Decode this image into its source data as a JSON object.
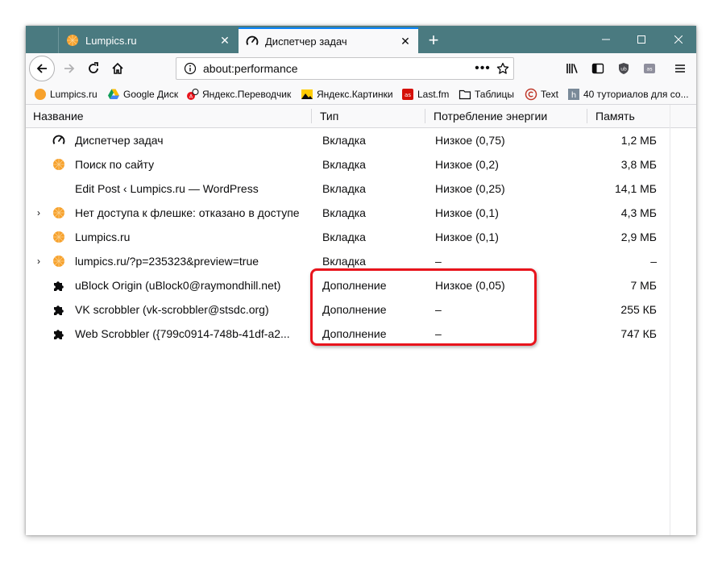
{
  "tabs": [
    {
      "title": "Lumpics.ru",
      "icon": "orange-circle-icon",
      "close": "✕"
    },
    {
      "title": "Диспетчер задач",
      "icon": "gauge-icon",
      "close": "✕"
    }
  ],
  "new_tab": "+",
  "window_controls": {
    "minimize": "—",
    "maximize": "☐",
    "close": "✕"
  },
  "url_bar": {
    "value": "about:performance",
    "dots": "•••"
  },
  "bookmarks": [
    {
      "label": "Lumpics.ru",
      "icon": "orange-circle-icon"
    },
    {
      "label": "Google Диск",
      "icon": "google-drive-icon"
    },
    {
      "label": "Яндекс.Переводчик",
      "icon": "yandex-translate-icon"
    },
    {
      "label": "Яндекс.Картинки",
      "icon": "yandex-images-icon"
    },
    {
      "label": "Last.fm",
      "icon": "lastfm-icon"
    },
    {
      "label": "Таблицы",
      "icon": "folder-icon"
    },
    {
      "label": "Text",
      "icon": "copyright-icon"
    },
    {
      "label": "40 туториалов для со...",
      "icon": "h-icon"
    }
  ],
  "table": {
    "headers": {
      "name": "Название",
      "type": "Тип",
      "energy": "Потребление энергии",
      "memory": "Память"
    },
    "rows": [
      {
        "twisty": "",
        "icon": "gauge-icon",
        "name": "Диспетчер задач",
        "type": "Вкладка",
        "energy": "Низкое (0,75)",
        "memory": "1,2 МБ"
      },
      {
        "twisty": "",
        "icon": "orange-circle-icon",
        "name": "Поиск по сайту",
        "type": "Вкладка",
        "energy": "Низкое (0,2)",
        "memory": "3,8 МБ"
      },
      {
        "twisty": "",
        "icon": "",
        "name": "Edit Post ‹ Lumpics.ru — WordPress",
        "type": "Вкладка",
        "energy": "Низкое (0,25)",
        "memory": "14,1 МБ"
      },
      {
        "twisty": "›",
        "icon": "orange-circle-icon",
        "name": "Нет доступа к флешке: отказано в доступе",
        "type": "Вкладка",
        "energy": "Низкое (0,1)",
        "memory": "4,3 МБ"
      },
      {
        "twisty": "",
        "icon": "orange-circle-icon",
        "name": "Lumpics.ru",
        "type": "Вкладка",
        "energy": "Низкое (0,1)",
        "memory": "2,9 МБ"
      },
      {
        "twisty": "›",
        "icon": "orange-circle-icon",
        "name": "lumpics.ru/?p=235323&preview=true",
        "type": "Вкладка",
        "energy": "–",
        "memory": "–"
      },
      {
        "twisty": "",
        "icon": "puzzle-icon",
        "name": "uBlock Origin (uBlock0@raymondhill.net)",
        "type": "Дополнение",
        "energy": "Низкое (0,05)",
        "memory": "7 МБ"
      },
      {
        "twisty": "",
        "icon": "puzzle-icon",
        "name": "VK scrobbler (vk-scrobbler@stsdc.org)",
        "type": "Дополнение",
        "energy": "–",
        "memory": "255 КБ"
      },
      {
        "twisty": "",
        "icon": "puzzle-icon",
        "name": "Web Scrobbler ({799c0914-748b-41df-a2...",
        "type": "Дополнение",
        "energy": "–",
        "memory": "747 КБ"
      }
    ]
  },
  "colors": {
    "tabbar": "#4a7a80",
    "accent": "#0a84ff",
    "highlight": "#e8141c",
    "favicon": "#f7a12c"
  }
}
